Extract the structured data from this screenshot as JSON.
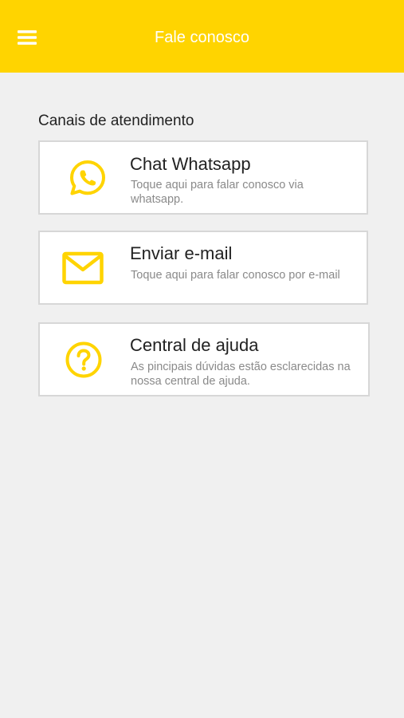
{
  "appbar": {
    "title": "Fale conosco",
    "menu_icon": "hamburger-menu-icon",
    "background_color": "#ffd400"
  },
  "section": {
    "title": "Canais de atendimento"
  },
  "channels": [
    {
      "icon": "whatsapp-icon",
      "title": "Chat Whatsapp",
      "description": "Toque aqui para falar conosco via whatsapp."
    },
    {
      "icon": "email-icon",
      "title": "Enviar e-mail",
      "description": "Toque aqui para falar conosco por e-mail"
    },
    {
      "icon": "help-question-icon",
      "title": "Central de ajuda",
      "description": "As pincipais dúvidas estão esclarecidas na nossa central de ajuda."
    }
  ],
  "accent_color": "#ffd400"
}
